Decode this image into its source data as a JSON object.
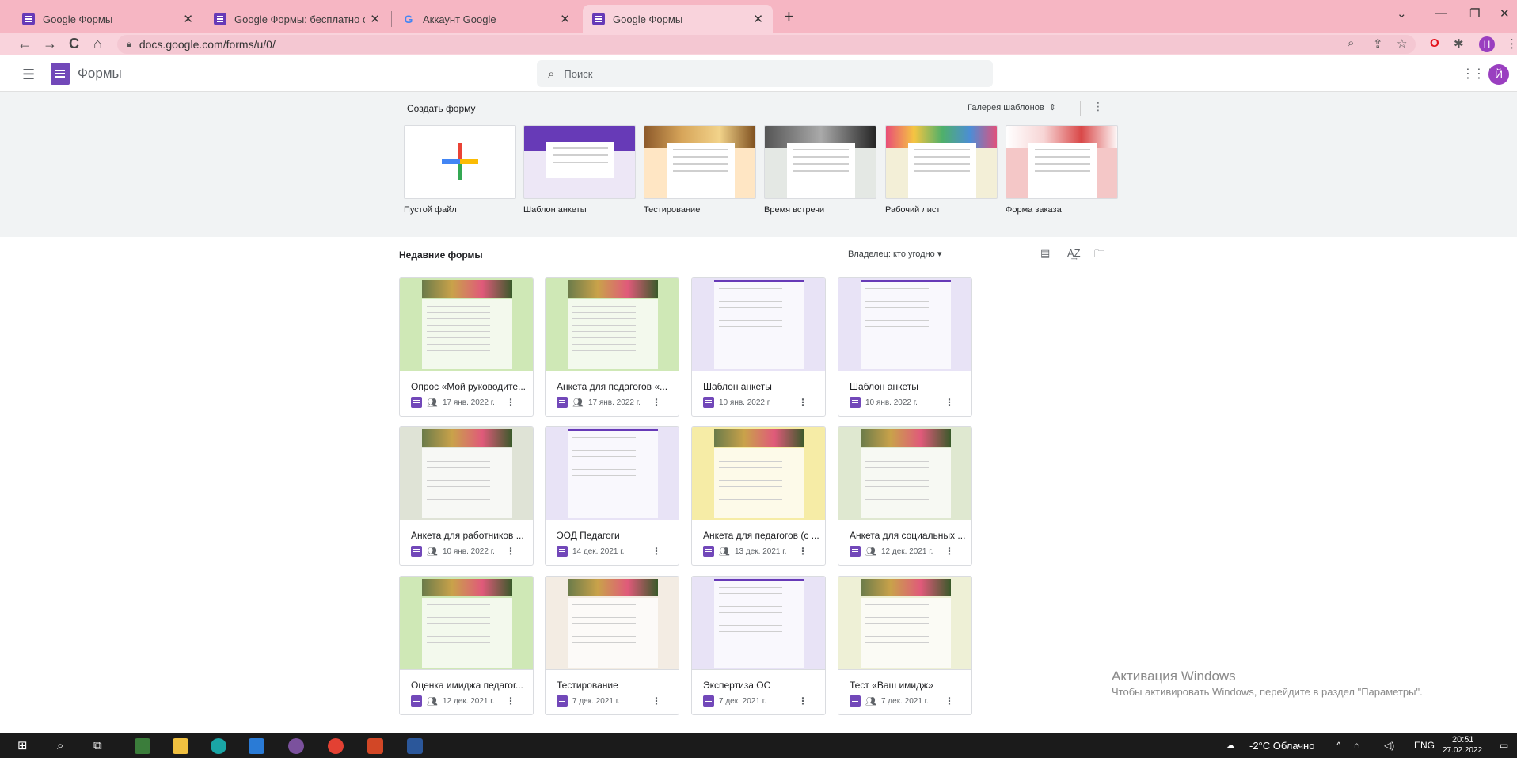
{
  "browser": {
    "tabs": [
      {
        "title": "Google Формы",
        "icon": "forms-icon",
        "active": false
      },
      {
        "title": "Google Формы: бесплатно созд",
        "icon": "forms-icon",
        "active": false
      },
      {
        "title": "Аккаунт Google",
        "icon": "google-icon",
        "active": false
      },
      {
        "title": "Google Формы",
        "icon": "forms-icon",
        "active": true
      }
    ],
    "url": "docs.google.com/forms/u/0/",
    "profile_initial": "Н"
  },
  "app": {
    "title": "Формы",
    "search_placeholder": "Поиск",
    "avatar_initial": "Й"
  },
  "templates": {
    "heading": "Создать форму",
    "gallery_label": "Галерея шаблонов",
    "items": [
      {
        "label": "Пустой файл",
        "color": "#ffffff"
      },
      {
        "label": "Шаблон анкеты",
        "color": "#673ab7"
      },
      {
        "label": "Тестирование",
        "color": "#ffe6c4"
      },
      {
        "label": "Время встречи",
        "color": "#e4e8e4"
      },
      {
        "label": "Рабочий лист",
        "color": "#f3efd7"
      },
      {
        "label": "Форма заказа",
        "color": "#f4c7c7"
      }
    ]
  },
  "recent": {
    "heading": "Недавние формы",
    "owner_filter": "Владелец: кто угодно",
    "forms": [
      {
        "title": "Опрос «Мой руководите...",
        "date": "17 янв. 2022 г.",
        "shared": true,
        "bg": "#cfe8b6"
      },
      {
        "title": "Анкета для педагогов «...",
        "date": "17 янв. 2022 г.",
        "shared": true,
        "bg": "#cfe8b6"
      },
      {
        "title": "Шаблон анкеты",
        "date": "10 янв. 2022 г.",
        "shared": false,
        "bg": "#e8e3f6"
      },
      {
        "title": "Шаблон анкеты",
        "date": "10 янв. 2022 г.",
        "shared": false,
        "bg": "#e8e3f6"
      },
      {
        "title": "Анкета для работников ...",
        "date": "10 янв. 2022 г.",
        "shared": true,
        "bg": "#dfe3d6"
      },
      {
        "title": "ЭОД Педагоги",
        "date": "14 дек. 2021 г.",
        "shared": false,
        "bg": "#e8e3f6"
      },
      {
        "title": "Анкета для педагогов (с ...",
        "date": "13 дек. 2021 г.",
        "shared": true,
        "bg": "#f6eca6"
      },
      {
        "title": "Анкета для социальных ...",
        "date": "12 дек. 2021 г.",
        "shared": true,
        "bg": "#dfe8d0"
      },
      {
        "title": "Оценка имиджа педагог...",
        "date": "12 дек. 2021 г.",
        "shared": true,
        "bg": "#cfe8b6"
      },
      {
        "title": "Тестирование",
        "date": "7 дек. 2021 г.",
        "shared": false,
        "bg": "#f3ece3"
      },
      {
        "title": "Экспертиза ОС",
        "date": "7 дек. 2021 г.",
        "shared": false,
        "bg": "#e8e3f6"
      },
      {
        "title": "Тест «Ваш имидж»",
        "date": "7 дек. 2021 г.",
        "shared": true,
        "bg": "#eef0d6"
      }
    ]
  },
  "watermark": {
    "line1": "Активация Windows",
    "line2": "Чтобы активировать Windows, перейдите в раздел \"Параметры\"."
  },
  "taskbar": {
    "weather": "-2°C  Облачно",
    "lang": "ENG",
    "time": "20:51",
    "date": "27.02.2022"
  }
}
